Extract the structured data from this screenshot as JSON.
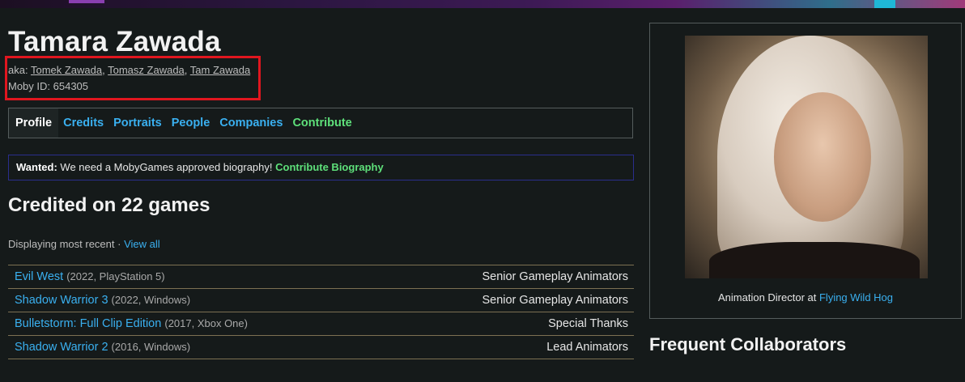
{
  "person": {
    "name": "Tamara Zawada",
    "aka_label": "aka:",
    "aka": [
      "Tomek Zawada",
      "Tomasz Zawada",
      "Tam Zawada"
    ],
    "aka_sep1": ", ",
    "aka_sep2": ", ",
    "moby_id_label": "Moby ID:",
    "moby_id": "654305"
  },
  "tabs": {
    "profile": "Profile",
    "credits": "Credits",
    "portraits": "Portraits",
    "people": "People",
    "companies": "Companies",
    "contribute": "Contribute"
  },
  "wanted": {
    "label": "Wanted:",
    "text": " We need a MobyGames approved biography! ",
    "link": "Contribute Biography"
  },
  "credits": {
    "heading": "Credited on 22 games",
    "displaying": "Displaying most recent · ",
    "view_all": "View all",
    "games": [
      {
        "title": "Evil West",
        "info": "(2022, PlayStation 5)",
        "role": "Senior Gameplay Animators"
      },
      {
        "title": "Shadow Warrior 3",
        "info": "(2022, Windows)",
        "role": "Senior Gameplay Animators"
      },
      {
        "title": "Bulletstorm: Full Clip Edition",
        "info": "(2017, Xbox One)",
        "role": "Special Thanks"
      },
      {
        "title": "Shadow Warrior 2",
        "info": "(2016, Windows)",
        "role": "Lead Animators"
      }
    ]
  },
  "sidebar": {
    "caption_prefix": "Animation Director at ",
    "company": "Flying Wild Hog",
    "frequent_heading": "Frequent Collaborators"
  },
  "colors": {
    "link": "#3ab0f0",
    "contribute": "#5ee07a",
    "highlight": "#e0161f",
    "background": "#151a1a"
  }
}
